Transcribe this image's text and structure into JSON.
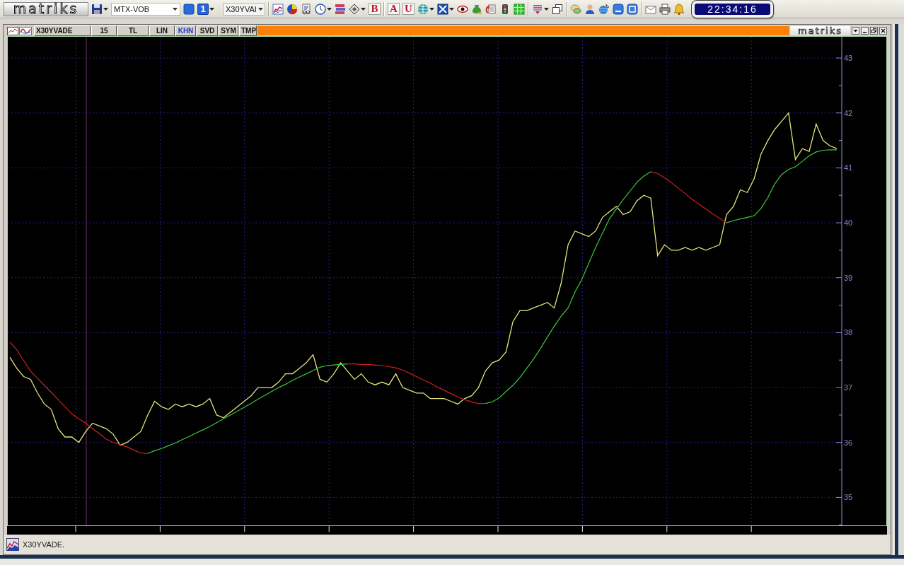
{
  "toolbar": {
    "logo": "matriks",
    "account": "MTX-VOB",
    "page_number": "1",
    "symbol": "X30YVAI",
    "letter_buttons": [
      "B",
      "A",
      "U"
    ],
    "clock": "22:34:16"
  },
  "chart_window": {
    "buttons": [
      {
        "label": "X30YVADE",
        "on": false
      },
      {
        "label": "15",
        "on": false
      },
      {
        "label": "TL",
        "on": false
      },
      {
        "label": "LIN",
        "on": false
      },
      {
        "label": "KHN",
        "on": true
      },
      {
        "label": "SVD",
        "on": false
      },
      {
        "label": "SYM",
        "on": false
      },
      {
        "label": "TMP",
        "on": false
      }
    ],
    "logo": "matriks",
    "chart_data": {
      "type": "line",
      "grid": true,
      "ylim": [
        34.49,
        43.4
      ],
      "yticks": [
        35,
        36,
        37,
        38,
        39,
        40,
        41,
        42,
        43
      ],
      "series": [
        {
          "color": "#e6e67a",
          "values": [
            37.55,
            37.35,
            37.2,
            37.15,
            36.9,
            36.7,
            36.6,
            36.25,
            36.1,
            36.1,
            36.0,
            36.2,
            36.35,
            36.3,
            36.25,
            36.15,
            35.95,
            36.0,
            36.1,
            36.2,
            36.5,
            36.75,
            36.65,
            36.6,
            36.7,
            36.65,
            36.7,
            36.65,
            36.7,
            36.8,
            36.5,
            36.45,
            36.55,
            36.65,
            36.75,
            36.85,
            37.0,
            37.0,
            37.0,
            37.1,
            37.25,
            37.25,
            37.35,
            37.45,
            37.6,
            37.15,
            37.1,
            37.25,
            37.45,
            37.3,
            37.15,
            37.25,
            37.1,
            37.05,
            37.1,
            37.05,
            37.25,
            37.0,
            36.95,
            36.9,
            36.9,
            36.8,
            36.8,
            36.8,
            36.75,
            36.7,
            36.8,
            36.85,
            37.0,
            37.3,
            37.45,
            37.5,
            37.65,
            38.2,
            38.4,
            38.4,
            38.45,
            38.5,
            38.55,
            38.45,
            38.9,
            39.6,
            39.85,
            39.8,
            39.75,
            39.85,
            40.1,
            40.2,
            40.3,
            40.15,
            40.2,
            40.4,
            40.5,
            40.45,
            39.4,
            39.6,
            39.5,
            39.5,
            39.55,
            39.5,
            39.55,
            39.5,
            39.55,
            39.6,
            40.15,
            40.3,
            40.6,
            40.55,
            40.8,
            41.25,
            41.5,
            41.7,
            41.85,
            42.0,
            41.15,
            41.35,
            41.3,
            41.8,
            41.5,
            41.4,
            41.35
          ]
        },
        {
          "color": "#3cc83c",
          "values": [
            null,
            null,
            null,
            null,
            null,
            null,
            null,
            null,
            null,
            null,
            null,
            null,
            null,
            null,
            null,
            null,
            null,
            null,
            null,
            null,
            35.8,
            35.85,
            35.89,
            35.94,
            35.99,
            36.05,
            36.11,
            36.17,
            36.23,
            36.29,
            36.36,
            36.43,
            36.5,
            36.57,
            36.64,
            36.71,
            36.79,
            36.86,
            36.93,
            37.0,
            37.06,
            37.13,
            37.19,
            37.25,
            37.31,
            37.37,
            37.4,
            37.41,
            37.42,
            37.43,
            null,
            null,
            null,
            null,
            null,
            null,
            null,
            null,
            null,
            null,
            null,
            null,
            null,
            null,
            null,
            null,
            null,
            null,
            null,
            36.71,
            36.74,
            36.81,
            36.93,
            37.04,
            37.18,
            37.35,
            37.52,
            37.71,
            37.92,
            38.12,
            38.3,
            38.45,
            38.74,
            38.97,
            39.26,
            39.55,
            39.81,
            40.07,
            40.25,
            40.42,
            40.58,
            40.74,
            40.85,
            40.93,
            null,
            null,
            null,
            null,
            null,
            null,
            null,
            null,
            null,
            null,
            40.0,
            40.04,
            40.07,
            40.1,
            40.13,
            40.26,
            40.46,
            40.71,
            40.88,
            40.97,
            41.02,
            41.12,
            41.22,
            41.29,
            41.32,
            41.33,
            41.33
          ]
        },
        {
          "color": "#d02020",
          "values": [
            37.83,
            37.69,
            37.49,
            37.3,
            37.17,
            37.04,
            36.91,
            36.78,
            36.65,
            36.52,
            36.43,
            36.35,
            36.25,
            36.16,
            36.06,
            36.0,
            35.96,
            35.92,
            35.86,
            35.81,
            35.8,
            null,
            null,
            null,
            null,
            null,
            null,
            null,
            null,
            null,
            null,
            null,
            null,
            null,
            null,
            null,
            null,
            null,
            null,
            null,
            null,
            null,
            null,
            null,
            null,
            null,
            null,
            null,
            null,
            37.43,
            37.43,
            37.42,
            37.42,
            37.41,
            37.4,
            37.38,
            37.36,
            37.32,
            37.26,
            37.2,
            37.14,
            37.08,
            37.01,
            36.95,
            36.89,
            36.83,
            36.78,
            36.74,
            36.71,
            36.71,
            null,
            null,
            null,
            null,
            null,
            null,
            null,
            null,
            null,
            null,
            null,
            null,
            null,
            null,
            null,
            null,
            null,
            null,
            null,
            null,
            null,
            null,
            null,
            40.93,
            40.9,
            40.82,
            40.73,
            40.63,
            40.53,
            40.43,
            40.34,
            40.25,
            40.16,
            40.08,
            40.0,
            null,
            null,
            null,
            null,
            null,
            null,
            null,
            null,
            null,
            null,
            null,
            null,
            null,
            null,
            null,
            null
          ]
        }
      ]
    }
  },
  "status_bar": {
    "text": "X30YVADE."
  }
}
